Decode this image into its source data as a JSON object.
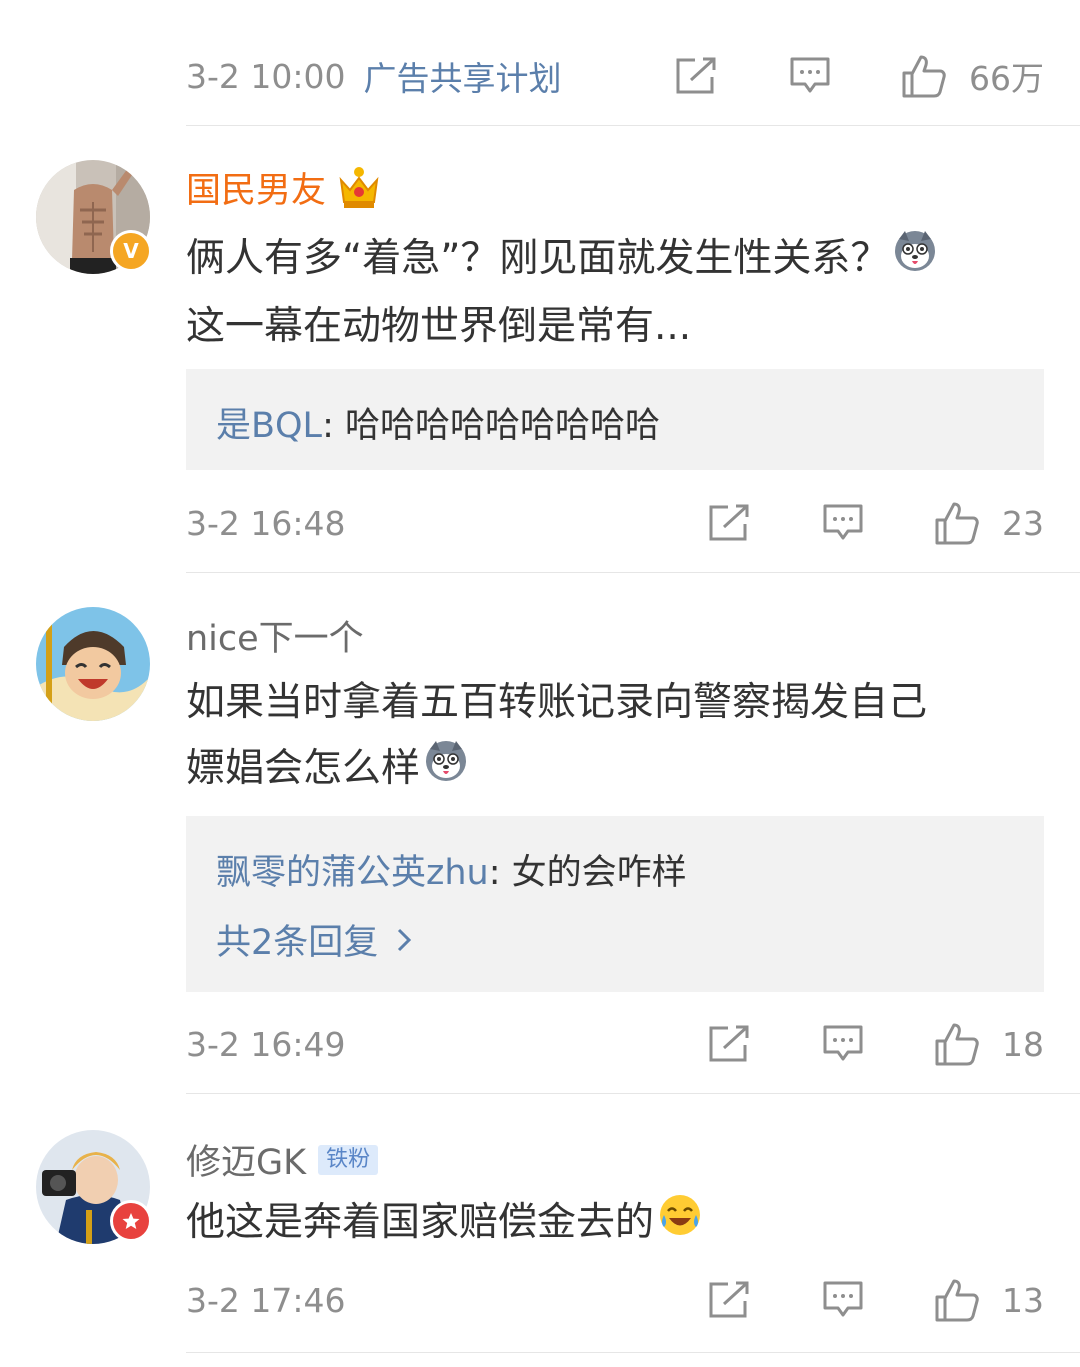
{
  "top_post": {
    "time": "3-2 10:00",
    "ad_label": "广告共享计划",
    "likes": "66万"
  },
  "comments": [
    {
      "username": "国民男友",
      "verified_badge": "V",
      "text_line1": "俩人有多“着急”？刚见面就发生性关系？",
      "text_line2": "这一幕在动物世界倒是常有...",
      "reply": {
        "user": "是BQL",
        "text": ": 哈哈哈哈哈哈哈哈哈"
      },
      "time": "3-2 16:48",
      "likes": "23"
    },
    {
      "username": "nice下一个",
      "text_line1": "如果当时拿着五百转账记录向警察揭发自己",
      "text_line2": "嫖娼会怎么样",
      "reply": {
        "user": "飘零的蒲公英zhu",
        "text": ": 女的会咋样",
        "more": "共2条回复"
      },
      "time": "3-2 16:49",
      "likes": "18"
    },
    {
      "username": "修迈GK",
      "fan_tag": "铁粉",
      "text_line1": "他这是奔着国家赔偿金去的",
      "time": "3-2 17:46",
      "likes": "13"
    }
  ],
  "colors": {
    "link_blue": "#5b7fab",
    "vip_orange": "#f26d13",
    "meta_gray": "#8e8e8e",
    "reply_bg": "#f2f2f2"
  },
  "icons": [
    "share-icon",
    "comment-icon",
    "like-icon",
    "crown-icon",
    "dog-emoji-icon",
    "laugh-cry-emoji-icon",
    "chevron-right-icon"
  ]
}
